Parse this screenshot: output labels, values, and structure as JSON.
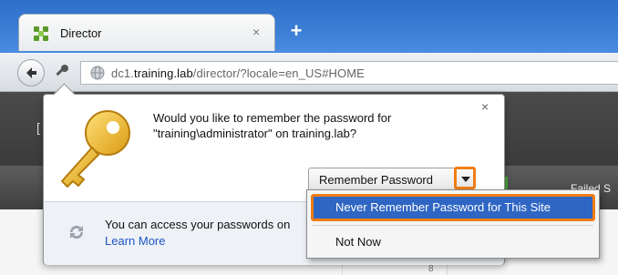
{
  "browser": {
    "tab_title": "Director",
    "tab_close": "×",
    "new_tab": "+",
    "url_host": "dc1.training.lab",
    "url_host_prefix": "dc1.",
    "url_host_main": "training.lab",
    "url_path": "/director/?locale=en_US#HOME"
  },
  "page": {
    "failed_label": "Failed S",
    "left_bracket": "[",
    "cell_number": "8"
  },
  "popup": {
    "message_line1": "Would you like to remember the password for",
    "message_line2": "\"training\\administrator\" on training.lab?",
    "close_symbol": "×",
    "remember_button": "Remember Password",
    "info_text": "You can access your passwords on",
    "learn_more": "Learn More"
  },
  "menu": {
    "items": [
      {
        "label": "Never Remember Password for This Site",
        "selected": true
      },
      {
        "label": "Not Now",
        "selected": false
      }
    ]
  },
  "colors": {
    "accent_orange": "#ef7d16",
    "selection_blue": "#2f66c4",
    "title_blue": "#3b7fd6"
  }
}
